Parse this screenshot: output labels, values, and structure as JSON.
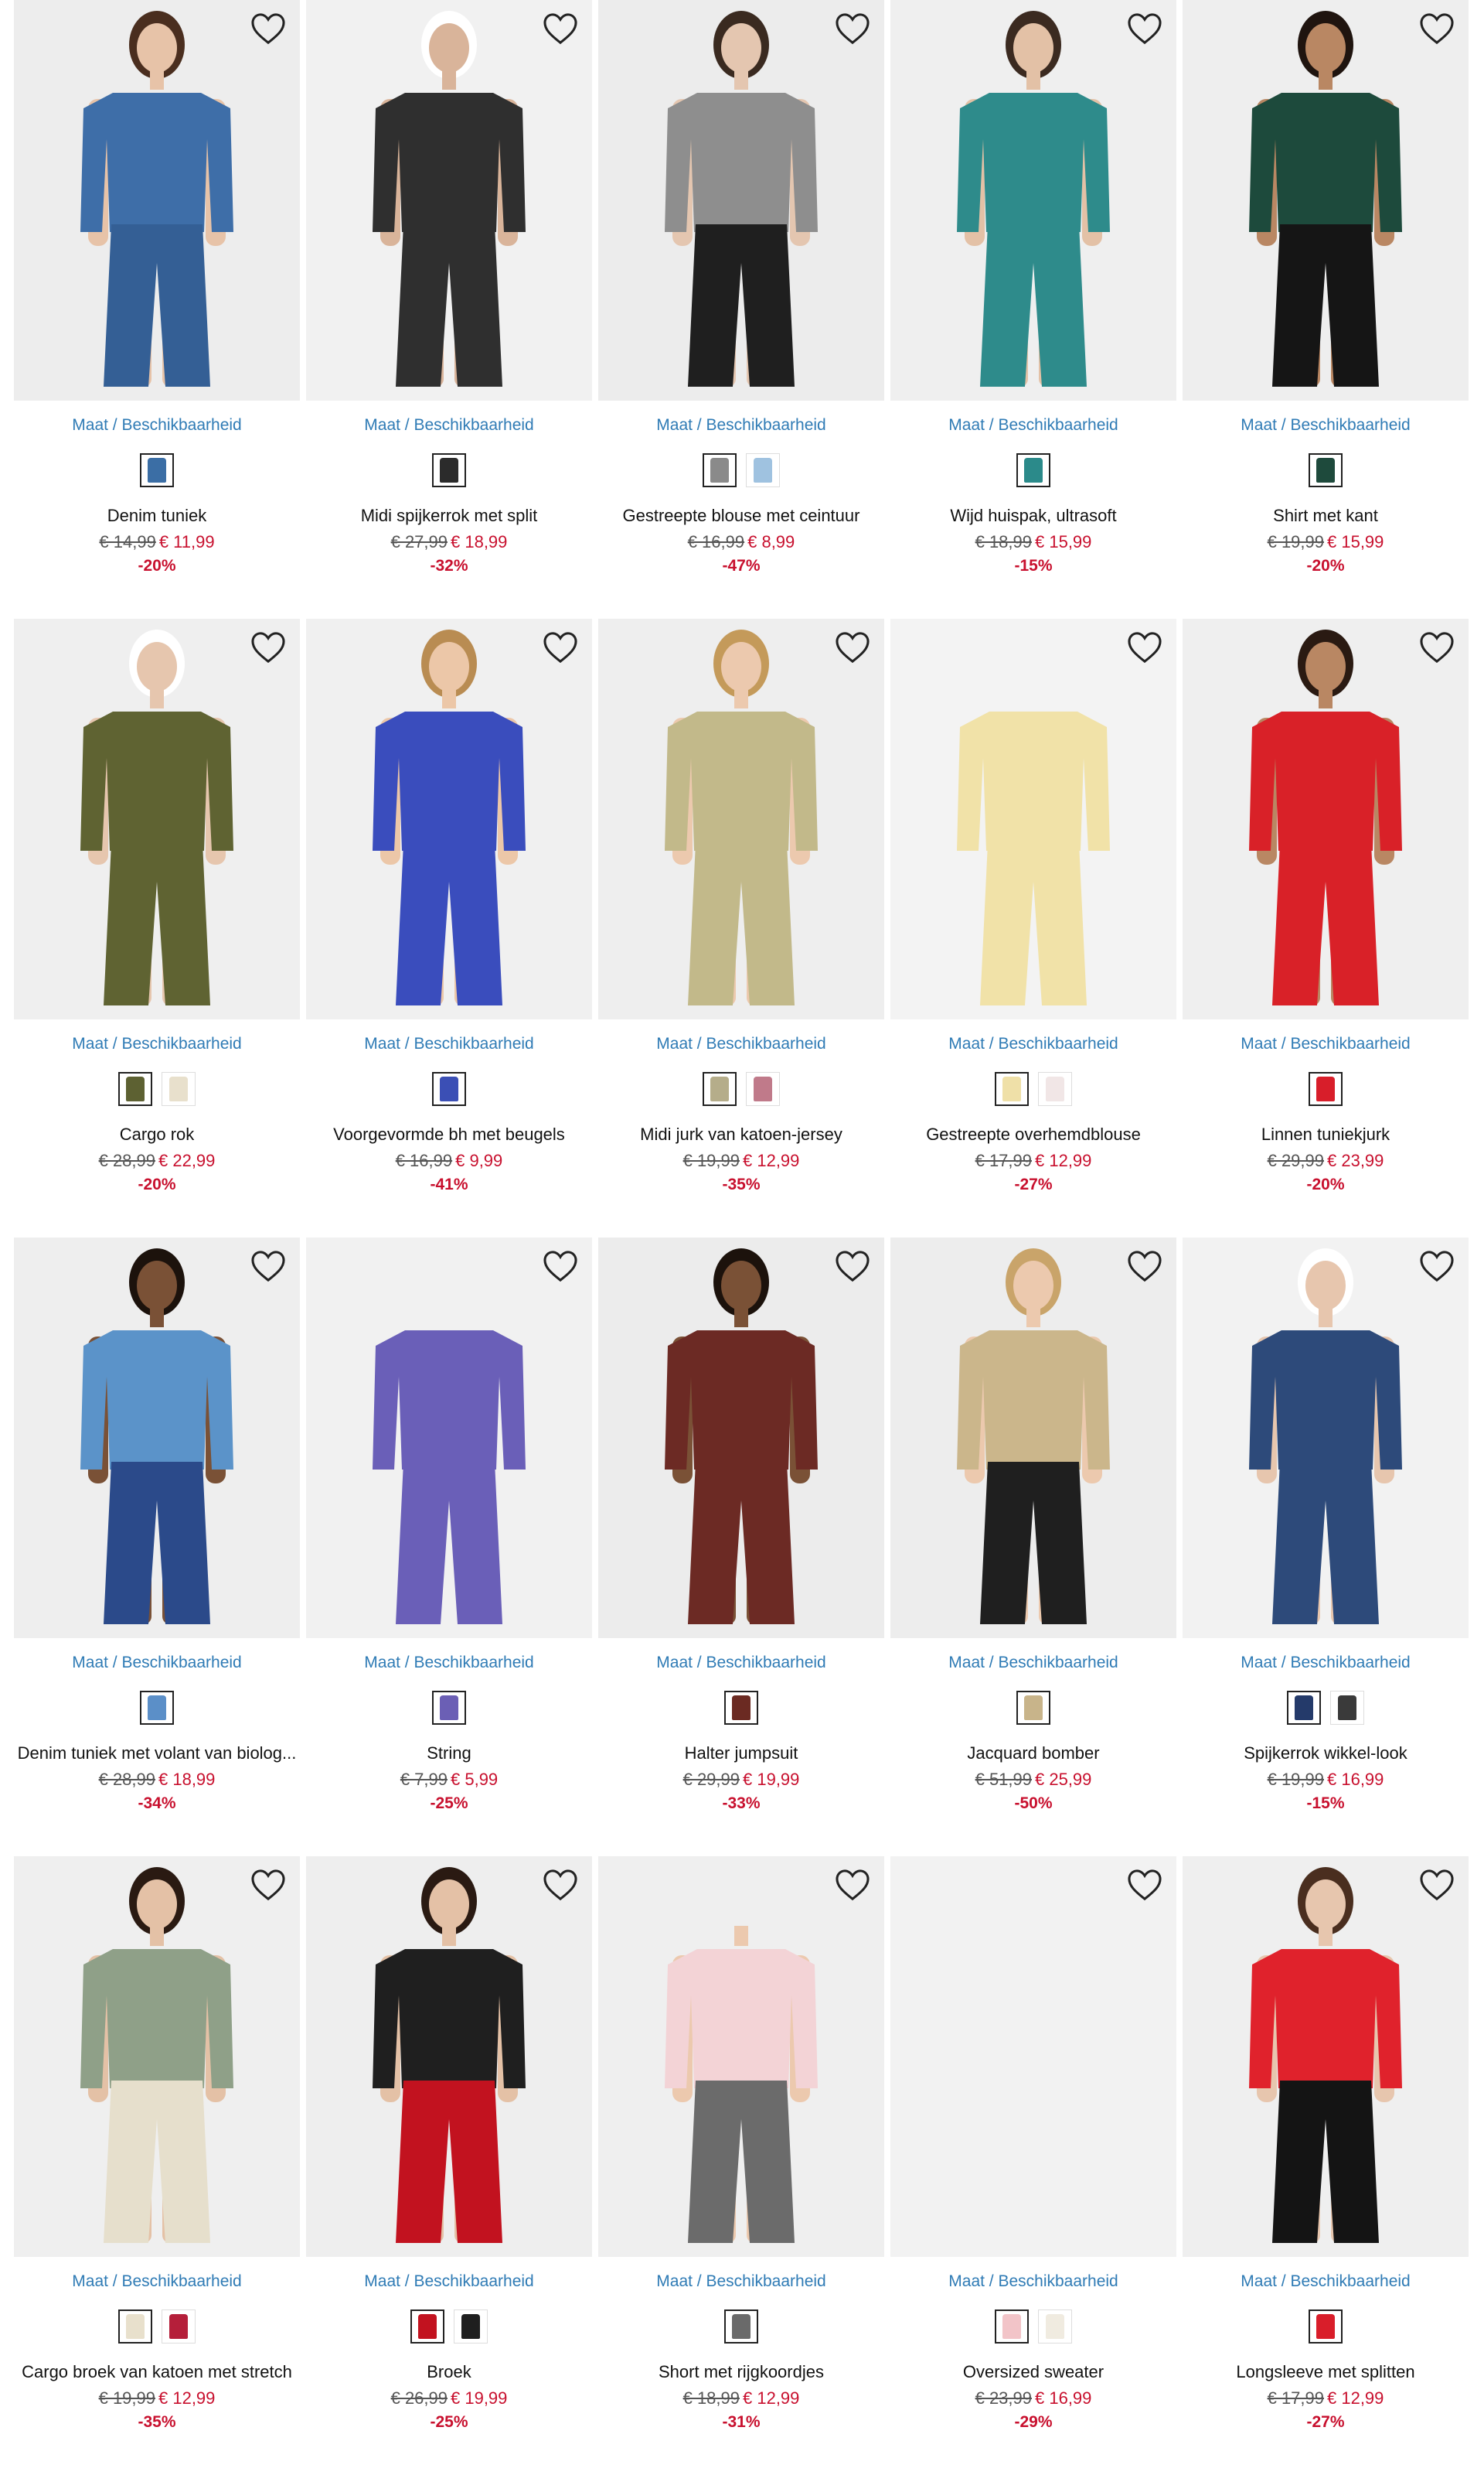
{
  "availability_label": "Maat / Beschikbaarheid",
  "products": [
    {
      "name": "Denim tuniek",
      "old_price": "€ 14,99",
      "new_price": "€ 11,99",
      "discount": "-20%",
      "swatches": [
        "#3b6ea5"
      ],
      "garment": "#3e6ea8",
      "pants": "#345f95",
      "skin": "#e7c3a8",
      "hair": "#4a2e1f",
      "bg": "#ededed"
    },
    {
      "name": "Midi spijkerrok met split",
      "old_price": "€ 27,99",
      "new_price": "€ 18,99",
      "discount": "-32%",
      "swatches": [
        "#2b2b2b"
      ],
      "garment": "#2f2f2f",
      "pants": "#2f2f2f",
      "skin": "#d9b49a",
      "hair": "#ffffff",
      "bg": "#f1f1f1"
    },
    {
      "name": "Gestreepte blouse met ceintuur",
      "old_price": "€ 16,99",
      "new_price": "€ 8,99",
      "discount": "-47%",
      "swatches": [
        "#8a8a8a",
        "#9fc2e0"
      ],
      "garment": "#8e8e8e",
      "pants": "#1f1f1f",
      "skin": "#e4c6b0",
      "hair": "#3a2a20",
      "bg": "#ececec"
    },
    {
      "name": "Wijd huispak, ultrasoft",
      "old_price": "€ 18,99",
      "new_price": "€ 15,99",
      "discount": "-15%",
      "swatches": [
        "#2b8a8a"
      ],
      "garment": "#2e8b8b",
      "pants": "#2e8b8b",
      "skin": "#e3c1a6",
      "hair": "#3b2a20",
      "bg": "#efefef"
    },
    {
      "name": "Shirt met kant",
      "old_price": "€ 19,99",
      "new_price": "€ 15,99",
      "discount": "-20%",
      "swatches": [
        "#1e4a3c"
      ],
      "garment": "#1d4a3c",
      "pants": "#151515",
      "skin": "#b98763",
      "hair": "#1f140f",
      "bg": "#eeeeee"
    },
    {
      "name": "Cargo rok",
      "old_price": "€ 28,99",
      "new_price": "€ 22,99",
      "discount": "-20%",
      "swatches": [
        "#5d6132",
        "#e8e0cc"
      ],
      "garment": "#5f6332",
      "pants": "#5f6332",
      "skin": "#e6c6ae",
      "hair": "#ffffff",
      "bg": "#efefef"
    },
    {
      "name": "Voorgevormde bh met beugels",
      "old_price": "€ 16,99",
      "new_price": "€ 9,99",
      "discount": "-41%",
      "swatches": [
        "#3b4fb5"
      ],
      "garment": "#3a4dbd",
      "pants": "#3a4dbd",
      "skin": "#ecc7a8",
      "hair": "#b98c52",
      "bg": "#f0f0f0"
    },
    {
      "name": "Midi jurk van katoen-jersey",
      "old_price": "€ 19,99",
      "new_price": "€ 12,99",
      "discount": "-35%",
      "swatches": [
        "#b5ad8a",
        "#c07a8a"
      ],
      "garment": "#c2b98a",
      "pants": "#c2b98a",
      "skin": "#ecc9ae",
      "hair": "#c49a5a",
      "bg": "#eeeeee"
    },
    {
      "name": "Gestreepte overhemdblouse",
      "old_price": "€ 17,99",
      "new_price": "€ 12,99",
      "discount": "-27%",
      "swatches": [
        "#efe0a8",
        "#f1e6e6"
      ],
      "garment": "#f1e2a8",
      "pants": "#f1e2a8",
      "skin": "none",
      "hair": "none",
      "bg": "#f3f3f3"
    },
    {
      "name": "Linnen tuniekjurk",
      "old_price": "€ 29,99",
      "new_price": "€ 23,99",
      "discount": "-20%",
      "swatches": [
        "#d81e2a"
      ],
      "garment": "#d92128",
      "pants": "#d92128",
      "skin": "#b98763",
      "hair": "#2a1a12",
      "bg": "#efefef"
    },
    {
      "name": "Denim tuniek met volant van biolog...",
      "old_price": "€ 28,99",
      "new_price": "€ 18,99",
      "discount": "-34%",
      "swatches": [
        "#5b8fc8"
      ],
      "garment": "#5b93c9",
      "pants": "#2b4a8a",
      "skin": "#7a5136",
      "hair": "#1c120c",
      "bg": "#eeeeee"
    },
    {
      "name": "String",
      "old_price": "€ 7,99",
      "new_price": "€ 5,99",
      "discount": "-25%",
      "swatches": [
        "#6b5fb5"
      ],
      "garment": "#6a5fb8",
      "pants": "#6a5fb8",
      "skin": "none",
      "hair": "none",
      "bg": "#f1f1f1"
    },
    {
      "name": "Halter jumpsuit",
      "old_price": "€ 29,99",
      "new_price": "€ 19,99",
      "discount": "-33%",
      "swatches": [
        "#6b2a22"
      ],
      "garment": "#6c2a24",
      "pants": "#6c2a24",
      "skin": "#7a5136",
      "hair": "#1c120c",
      "bg": "#ececec"
    },
    {
      "name": "Jacquard bomber",
      "old_price": "€ 51,99",
      "new_price": "€ 25,99",
      "discount": "-50%",
      "swatches": [
        "#c8b48a"
      ],
      "garment": "#cbb68b",
      "pants": "#1f1f1f",
      "skin": "#ecc9ae",
      "hair": "#c9a46a",
      "bg": "#ededed"
    },
    {
      "name": "Spijkerrok wikkel-look",
      "old_price": "€ 19,99",
      "new_price": "€ 16,99",
      "discount": "-15%",
      "swatches": [
        "#243a6a",
        "#3a3a3a"
      ],
      "garment": "#2d4a7a",
      "pants": "#2d4a7a",
      "skin": "#e7c6ae",
      "hair": "#ffffff",
      "bg": "#f2f2f2"
    },
    {
      "name": "Cargo broek van katoen met stretch",
      "old_price": "€ 19,99",
      "new_price": "€ 12,99",
      "discount": "-35%",
      "swatches": [
        "#e8e0cc",
        "#b51f3a"
      ],
      "garment": "#8fa088",
      "pants": "#e6dfcc",
      "skin": "#e4c1a6",
      "hair": "#2a1a12",
      "bg": "#efefef"
    },
    {
      "name": "Broek",
      "old_price": "€ 26,99",
      "new_price": "€ 19,99",
      "discount": "-25%",
      "swatches": [
        "#c2121f",
        "#1f1f1f"
      ],
      "garment": "#1f1f1f",
      "pants": "#c2121f",
      "skin": "#e4c1a6",
      "hair": "#2a1a12",
      "bg": "#eeeeee"
    },
    {
      "name": "Short met rijgkoordjes",
      "old_price": "€ 18,99",
      "new_price": "€ 12,99",
      "discount": "-31%",
      "swatches": [
        "#6a6a6a"
      ],
      "garment": "#f3d3d6",
      "pants": "#6b6b6b",
      "skin": "#ecc9ae",
      "hair": "none",
      "bg": "#efefef"
    },
    {
      "name": "Oversized sweater",
      "old_price": "€ 23,99",
      "new_price": "€ 16,99",
      "discount": "-29%",
      "swatches": [
        "#f2c4c8",
        "#f0ebe0"
      ],
      "garment": "none",
      "pants": "none",
      "skin": "none",
      "hair": "none",
      "bg": "#f2f2f2"
    },
    {
      "name": "Longsleeve met splitten",
      "old_price": "€ 17,99",
      "new_price": "€ 12,99",
      "discount": "-27%",
      "swatches": [
        "#d91e2a"
      ],
      "garment": "#e0222c",
      "pants": "#141414",
      "skin": "#e7c6ae",
      "hair": "#4a2e1f",
      "bg": "#efefef"
    }
  ]
}
